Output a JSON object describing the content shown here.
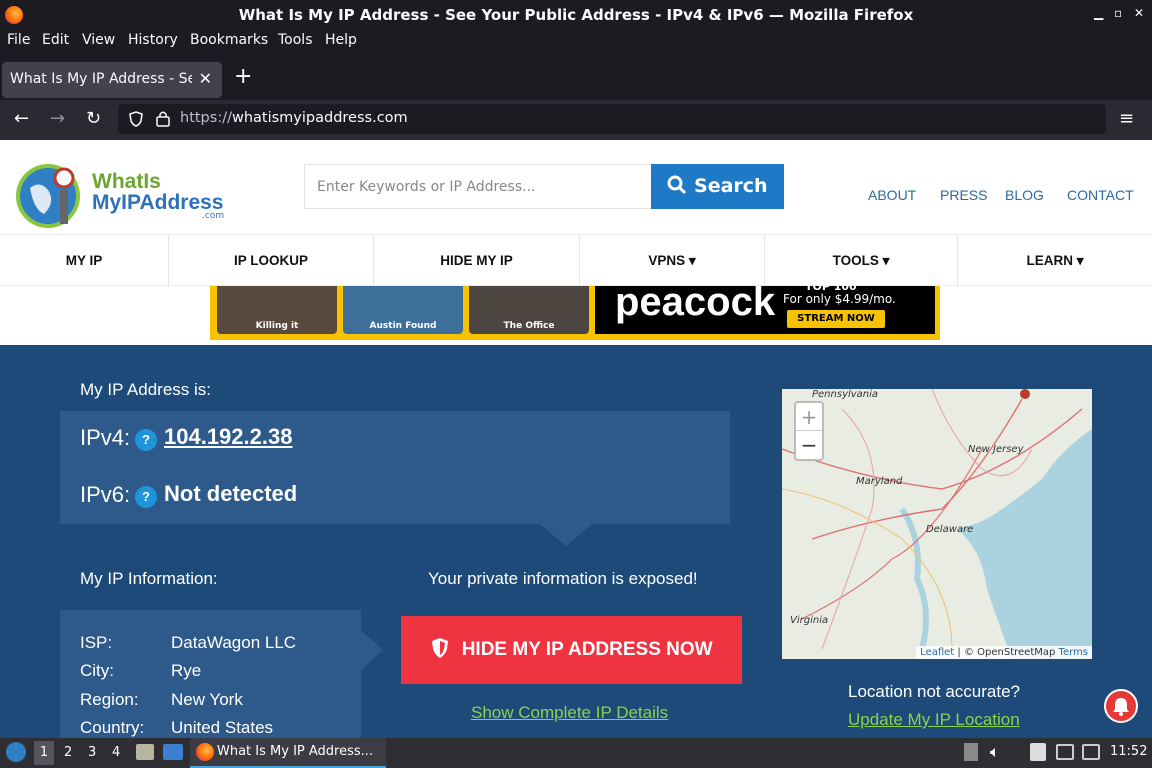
{
  "window": {
    "title": "What Is My IP Address - See Your Public Address - IPv4 & IPv6 — Mozilla Firefox"
  },
  "menu": [
    "File",
    "Edit",
    "View",
    "History",
    "Bookmarks",
    "Tools",
    "Help"
  ],
  "tab": {
    "title": "What Is My IP Address - See Your Public Address"
  },
  "url": {
    "protocol": "https://",
    "host": "whatismyipaddress.com"
  },
  "site": {
    "logo_line1": "WhatIs",
    "logo_line2": "MyIPAddress",
    "logo_suffix": ".com",
    "search_placeholder": "Enter Keywords or IP Address...",
    "search_label": "Search",
    "toplinks": [
      "ABOUT",
      "PRESS",
      "BLOG",
      "CONTACT"
    ],
    "nav": [
      "MY IP",
      "IP LOOKUP",
      "HIDE MY IP",
      "VPNS ▾",
      "TOOLS ▾",
      "LEARN ▾"
    ]
  },
  "ad": {
    "captions": [
      "Killing it",
      "Austin Found",
      "The Office"
    ],
    "brand": "peacock",
    "tagline_top": "TOP 100",
    "tagline": "For only $4.99/mo.",
    "cta": "STREAM NOW"
  },
  "ip": {
    "heading": "My IP Address is:",
    "v4_label": "IPv4:",
    "v4_value": "104.192.2.38",
    "v6_label": "IPv6:",
    "v6_value": "Not detected",
    "help": "?"
  },
  "info": {
    "heading": "My IP Information:",
    "rows": [
      {
        "k": "ISP:",
        "v": "DataWagon LLC"
      },
      {
        "k": "City:",
        "v": "Rye"
      },
      {
        "k": "Region:",
        "v": "New York"
      },
      {
        "k": "Country:",
        "v": "United States"
      }
    ]
  },
  "exposed": "Your private information is exposed!",
  "hide_btn": "HIDE MY IP ADDRESS NOW",
  "details_link": "Show Complete IP Details",
  "map": {
    "labels": [
      "Pennsylvania",
      "New Jersey",
      "Maryland",
      "Delaware",
      "Virginia"
    ],
    "zoom_in": "+",
    "zoom_out": "−",
    "attrib_leaflet": "Leaflet",
    "attrib_osm": "| © OpenStreetMap",
    "attrib_terms": "Terms"
  },
  "location": {
    "question": "Location not accurate?",
    "update": "Update My IP Location"
  },
  "taskbar": {
    "workspaces": [
      "1",
      "2",
      "3",
      "4"
    ],
    "app": "What Is My IP Address...",
    "clock": "11:52"
  },
  "colors": {
    "hero": "#1e4a7a",
    "box": "#2d5a8a",
    "accent": "#1e7ac7",
    "red": "#ef3340",
    "green": "#8bd14b"
  }
}
